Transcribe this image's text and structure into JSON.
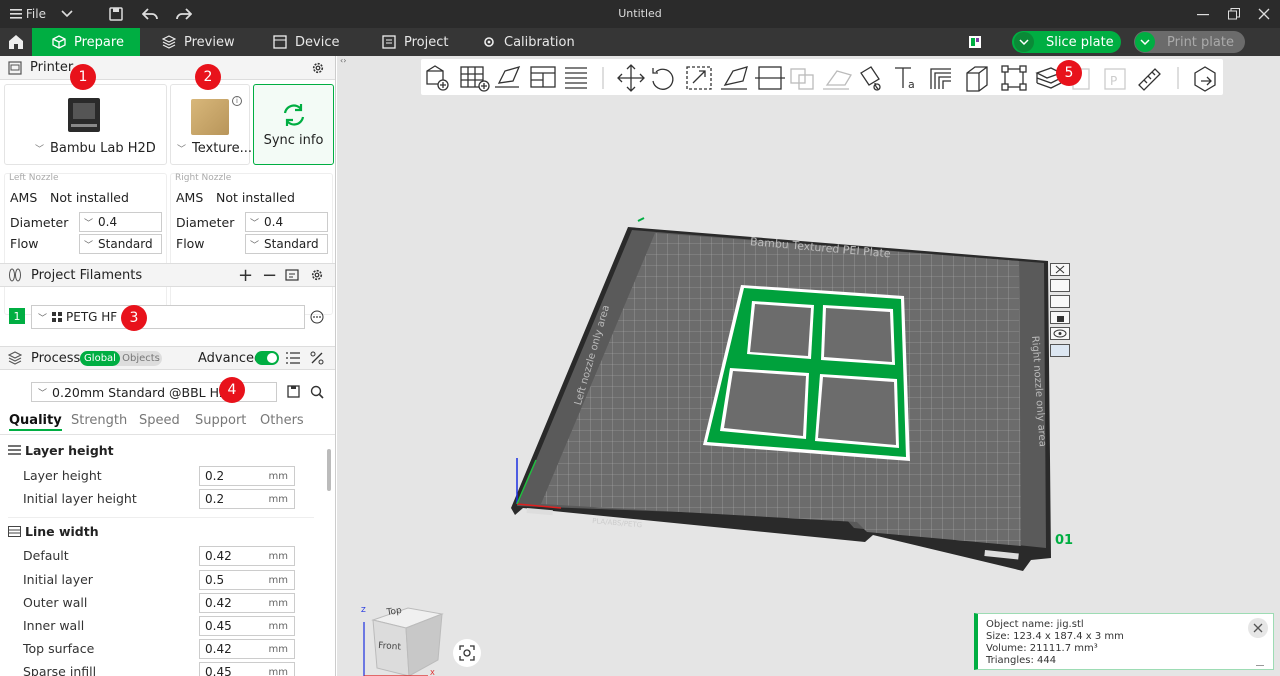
{
  "window": {
    "title": "Untitled",
    "file_label": "File"
  },
  "tabs": [
    {
      "label": "Prepare"
    },
    {
      "label": "Preview"
    },
    {
      "label": "Device"
    },
    {
      "label": "Project"
    },
    {
      "label": "Calibration"
    }
  ],
  "actions": {
    "slice": "Slice plate",
    "print": "Print plate"
  },
  "printer": {
    "section_title": "Printer",
    "name": "Bambu Lab H2D",
    "plate": "Texture...",
    "sync": "Sync info",
    "left_nozzle": {
      "title": "Left Nozzle",
      "ams_label": "AMS",
      "ams_value": "Not installed",
      "diameter_label": "Diameter",
      "diameter": "0.4",
      "flow_label": "Flow",
      "flow": "Standard"
    },
    "right_nozzle": {
      "title": "Right Nozzle",
      "ams_label": "AMS",
      "ams_value": "Not installed",
      "diameter_label": "Diameter",
      "diameter": "0.4",
      "flow_label": "Flow",
      "flow": "Standard"
    }
  },
  "filaments": {
    "section_title": "Project Filaments",
    "items": [
      {
        "index": "1",
        "name": "PETG HF",
        "color": "#00ae42"
      }
    ]
  },
  "process": {
    "section_title": "Process",
    "global": "Global",
    "objects": "Objects",
    "advanced": "Advanced",
    "preset": "0.20mm Standard @BBL H2D",
    "tabs": [
      "Quality",
      "Strength",
      "Speed",
      "Support",
      "Others"
    ],
    "groups": [
      {
        "title": "Layer height",
        "params": [
          {
            "label": "Layer height",
            "value": "0.2",
            "unit": "mm"
          },
          {
            "label": "Initial layer height",
            "value": "0.2",
            "unit": "mm"
          }
        ]
      },
      {
        "title": "Line width",
        "params": [
          {
            "label": "Default",
            "value": "0.42",
            "unit": "mm"
          },
          {
            "label": "Initial layer",
            "value": "0.5",
            "unit": "mm"
          },
          {
            "label": "Outer wall",
            "value": "0.42",
            "unit": "mm"
          },
          {
            "label": "Inner wall",
            "value": "0.45",
            "unit": "mm"
          },
          {
            "label": "Top surface",
            "value": "0.42",
            "unit": "mm"
          },
          {
            "label": "Sparse infill",
            "value": "0.45",
            "unit": "mm"
          }
        ]
      }
    ]
  },
  "badges": [
    "1",
    "2",
    "3",
    "4",
    "5"
  ],
  "plate": {
    "title": "Bambu Textured PEI Plate",
    "left_label": "Left nozzle only area",
    "right_label": "Right nozzle only area",
    "tag": "PLA/ABS/PETG",
    "number": "01"
  },
  "cube": {
    "top": "Top",
    "front": "Front",
    "axis_z": "Z",
    "axis_x": "X"
  },
  "object_info": {
    "name": "Object name: jig.stl",
    "size": "Size: 123.4 x 187.4 x 3 mm",
    "volume": "Volume: 21111.7 mm³",
    "triangles": "Triangles: 444"
  },
  "colors": {
    "accent": "#00ae42",
    "badge": "#e8121b",
    "bar": "#363636"
  }
}
